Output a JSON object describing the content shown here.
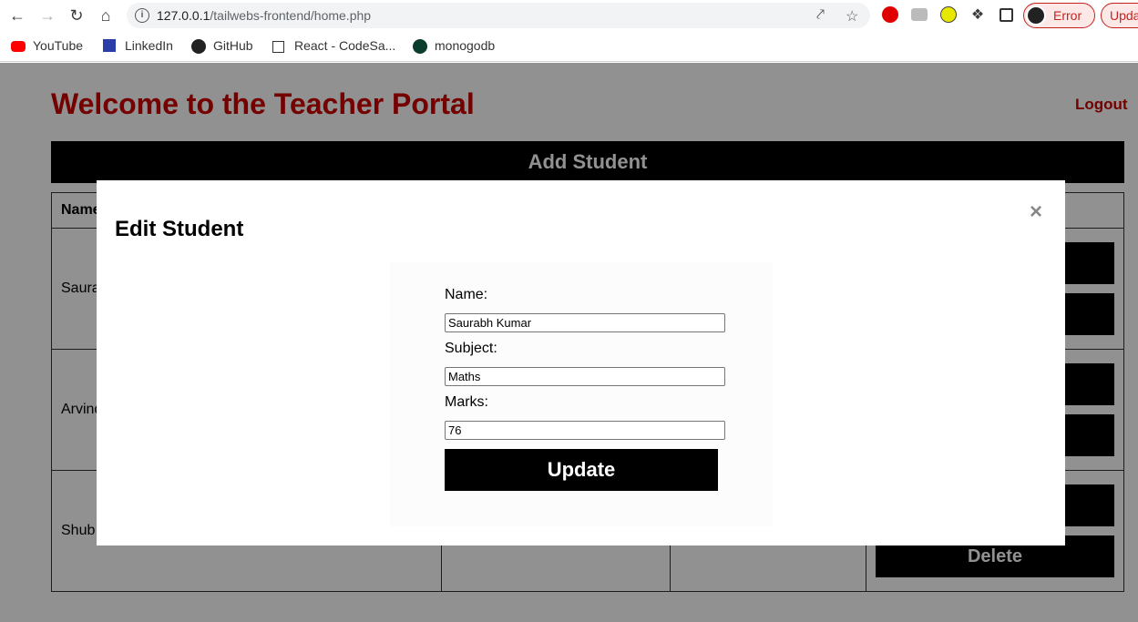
{
  "browser": {
    "url_host": "127.0.0.1",
    "url_path": "/tailwebs-frontend/home.php",
    "profile_status": "Error",
    "update_label": "Upda",
    "bookmarks": [
      {
        "label": "YouTube",
        "icon": "youtube-icon"
      },
      {
        "label": "LinkedIn",
        "icon": "linkedin-icon"
      },
      {
        "label": "GitHub",
        "icon": "github-icon"
      },
      {
        "label": "React - CodeSa...",
        "icon": "page-icon"
      },
      {
        "label": "monogodb",
        "icon": "mongodb-icon"
      }
    ]
  },
  "page": {
    "title": "Welcome to the Teacher Portal",
    "logout_label": "Logout",
    "add_student_label": "Add Student",
    "table": {
      "header_name": "Name",
      "rows": [
        {
          "name": "Saura"
        },
        {
          "name": "Arvind"
        },
        {
          "name": "Shub"
        }
      ],
      "delete_label": "Delete"
    }
  },
  "modal": {
    "title": "Edit Student",
    "close_symbol": "×",
    "fields": {
      "name_label": "Name:",
      "name_value": "Saurabh Kumar",
      "subject_label": "Subject:",
      "subject_value": "Maths",
      "marks_label": "Marks:",
      "marks_value": "76"
    },
    "update_label": "Update"
  },
  "colors": {
    "accent_red": "#cc0000",
    "button_black": "#000000"
  }
}
